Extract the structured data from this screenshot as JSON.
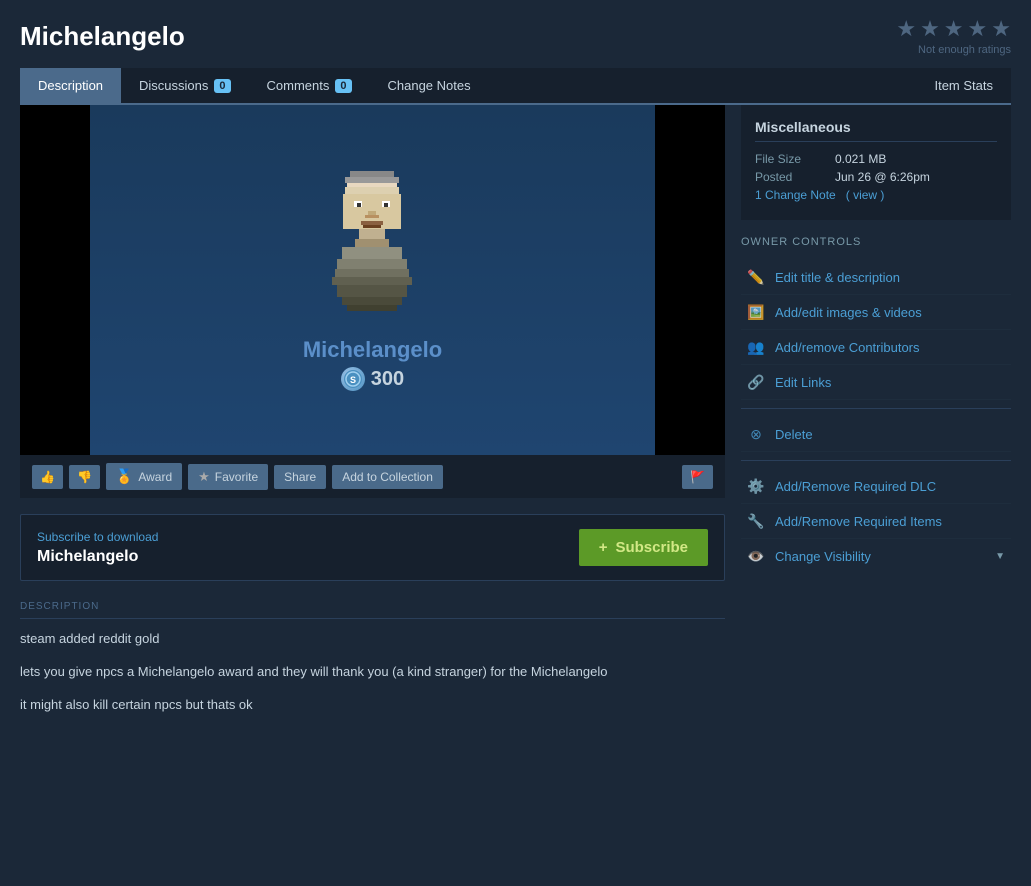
{
  "header": {
    "title": "Michelangelo",
    "stars": [
      "★",
      "★",
      "★",
      "★",
      "★"
    ],
    "rating_text": "Not enough ratings"
  },
  "tabs": [
    {
      "id": "description",
      "label": "Description",
      "active": true,
      "badge": null
    },
    {
      "id": "discussions",
      "label": "Discussions",
      "active": false,
      "badge": "0"
    },
    {
      "id": "comments",
      "label": "Comments",
      "active": false,
      "badge": "0"
    },
    {
      "id": "change-notes",
      "label": "Change Notes",
      "active": false,
      "badge": null
    },
    {
      "id": "item-stats",
      "label": "Item Stats",
      "active": false,
      "badge": null,
      "right": true
    }
  ],
  "misc": {
    "title": "Miscellaneous",
    "file_size_label": "File Size",
    "file_size_value": "0.021 MB",
    "posted_label": "Posted",
    "posted_value": "Jun 26 @ 6:26pm",
    "change_note_link": "1 Change Note",
    "change_note_view": "( view )"
  },
  "preview": {
    "caption": "Michelangelo",
    "points": "300"
  },
  "action_bar": {
    "thumbs_up": "👍",
    "thumbs_down": "👎",
    "award_label": "Award",
    "favorite_label": "Favorite",
    "share_label": "Share",
    "add_to_collection_label": "Add to Collection",
    "flag": "🚩"
  },
  "subscribe": {
    "label": "Subscribe to download",
    "name": "Michelangelo",
    "button_icon": "+",
    "button_label": "Subscribe"
  },
  "description": {
    "section_label": "DESCRIPTION",
    "paragraphs": [
      "steam added reddit gold",
      "lets you give npcs a Michelangelo award and they will thank you (a kind stranger) for the Michelangelo",
      "it might also kill certain npcs but thats ok"
    ]
  },
  "owner_controls": {
    "title": "OWNER CONTROLS",
    "items": [
      {
        "id": "edit-title",
        "label": "Edit title & description",
        "icon": "✏️"
      },
      {
        "id": "add-images",
        "label": "Add/edit images & videos",
        "icon": "🖼️"
      },
      {
        "id": "contributors",
        "label": "Add/remove Contributors",
        "icon": "👥"
      },
      {
        "id": "edit-links",
        "label": "Edit Links",
        "icon": "🔗"
      }
    ],
    "delete_label": "Delete",
    "delete_icon": "⊗",
    "extra_items": [
      {
        "id": "required-dlc",
        "label": "Add/Remove Required DLC",
        "icon": "⚙️"
      },
      {
        "id": "required-items",
        "label": "Add/Remove Required Items",
        "icon": "🔧"
      }
    ],
    "visibility_label": "Change Visibility",
    "visibility_icon": "👁️"
  }
}
